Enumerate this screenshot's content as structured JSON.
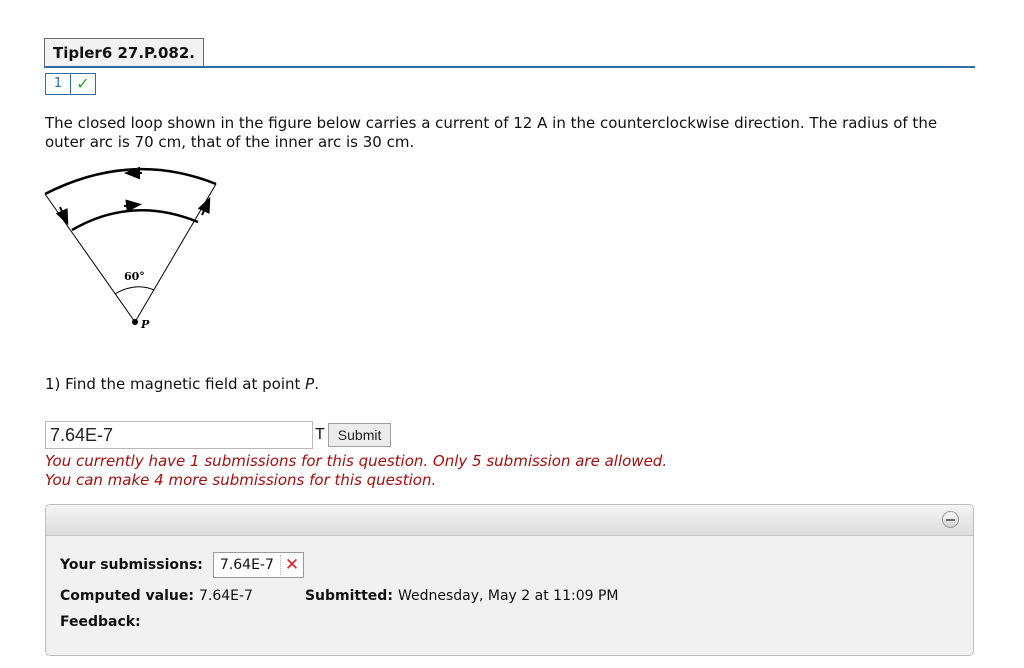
{
  "header": {
    "title": "Tipler6 27.P.082."
  },
  "part_nav": {
    "number": "1",
    "status_icon": "check-icon"
  },
  "question": {
    "text": "The closed loop shown in the figure below carries a current of 12 A in the counterclockwise direction. The radius of the outer arc is 70 cm, that of the inner arc is 30 cm.",
    "figure_angle_label": "60°",
    "figure_point_label": "P"
  },
  "part1": {
    "prompt": "1) Find the magnetic field at point ",
    "prompt_var": "P",
    "prompt_end": ".",
    "answer_value": "7.64E-7",
    "unit": "T",
    "submit_label": "Submit",
    "notice_line1": "You currently have 1 submissions for this question. Only 5 submission are allowed.",
    "notice_line2": "You can make 4 more submissions for this question."
  },
  "submissions_panel": {
    "your_submissions_label": "Your submissions:",
    "submission_value": "7.64E-7",
    "computed_label": "Computed value:",
    "computed_value": "7.64E-7",
    "submitted_label": "Submitted:",
    "submitted_value": "Wednesday, May 2 at 11:09 PM",
    "feedback_label": "Feedback:"
  },
  "colors": {
    "accent": "#2e6da4",
    "error": "#a01010",
    "correct": "#29a329",
    "wrong": "#e01b1b"
  }
}
